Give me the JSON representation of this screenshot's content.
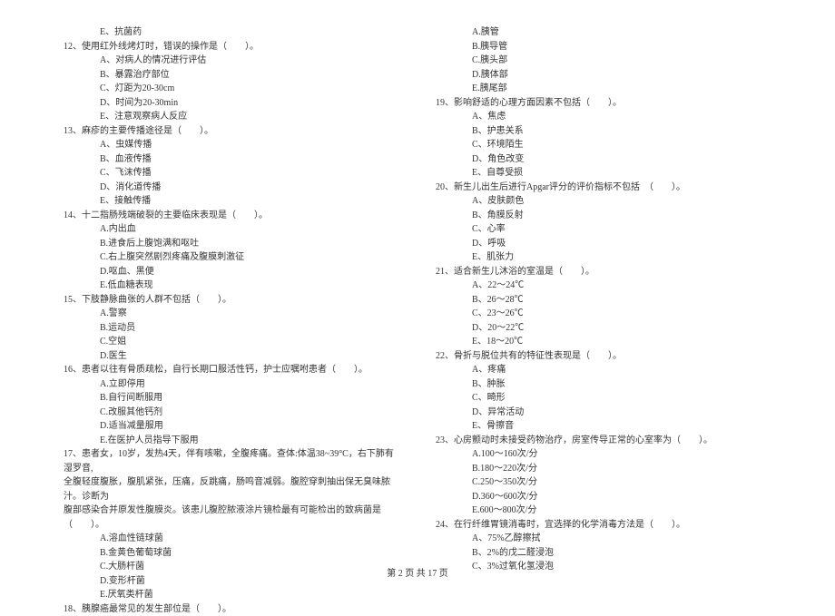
{
  "left": [
    {
      "cls": "opt",
      "t": "E、抗菌药"
    },
    {
      "cls": "q",
      "t": "12、使用红外线烤灯时，错误的操作是（　　）。"
    },
    {
      "cls": "opt",
      "t": "A、对病人的情况进行评估"
    },
    {
      "cls": "opt",
      "t": "B、暴露治疗部位"
    },
    {
      "cls": "opt",
      "t": "C、灯距为20-30cm"
    },
    {
      "cls": "opt",
      "t": "D、时间为20-30min"
    },
    {
      "cls": "opt",
      "t": "E、注意观察病人反应"
    },
    {
      "cls": "q",
      "t": "13、麻疹的主要传播途径是（　　）。"
    },
    {
      "cls": "opt",
      "t": "A、虫媒传播"
    },
    {
      "cls": "opt",
      "t": "B、血液传播"
    },
    {
      "cls": "opt",
      "t": "C、飞沫传播"
    },
    {
      "cls": "opt",
      "t": "D、消化道传播"
    },
    {
      "cls": "opt",
      "t": "E、接触传播"
    },
    {
      "cls": "q",
      "t": "14、十二指肠残端破裂的主要临床表现是（　　）。"
    },
    {
      "cls": "opt",
      "t": "A.内出血"
    },
    {
      "cls": "opt",
      "t": "B.进食后上腹饱满和呕吐"
    },
    {
      "cls": "opt",
      "t": "C.右上腹突然剧烈疼痛及腹膜刺激征"
    },
    {
      "cls": "opt",
      "t": "D.呕血、黑便"
    },
    {
      "cls": "opt",
      "t": "E.低血糖表现"
    },
    {
      "cls": "q",
      "t": "15、下肢静脉曲张的人群不包括（　　）。"
    },
    {
      "cls": "opt",
      "t": "A.警察"
    },
    {
      "cls": "opt",
      "t": "B.运动员"
    },
    {
      "cls": "opt",
      "t": "C.空姐"
    },
    {
      "cls": "opt",
      "t": "D.医生"
    },
    {
      "cls": "q",
      "t": "16、患者以往有骨质疏松，自行长期口服活性钙，护士应嘱咐患者（　　）。"
    },
    {
      "cls": "opt",
      "t": "A.立即停用"
    },
    {
      "cls": "opt",
      "t": "B.自行间断服用"
    },
    {
      "cls": "opt",
      "t": "C.改服其他钙剂"
    },
    {
      "cls": "opt",
      "t": "D.适当减量服用"
    },
    {
      "cls": "opt",
      "t": "E.在医护人员指导下服用"
    },
    {
      "cls": "q",
      "t": "17、患者女，10岁，发热4天，伴有咳嗽，全腹疼痛。查体:体温38~39°C，右下肺有湿罗音,"
    },
    {
      "cls": "q",
      "t": "全腹轻度腹胀，腹肌紧张，压痛，反跳痛，肠鸣音减弱。腹腔穿刺抽出保无臭味脓汁。诊断为"
    },
    {
      "cls": "q",
      "t": "腹部感染合并原发性腹膜炎。该患儿腹腔脓液涂片镜检最有可能检出的致病菌是（　　）。"
    },
    {
      "cls": "opt",
      "t": "A.溶血性链球菌"
    },
    {
      "cls": "opt",
      "t": "B.金黄色葡萄球菌"
    },
    {
      "cls": "opt",
      "t": "C.大肠杆菌"
    },
    {
      "cls": "opt",
      "t": "D.变形杆菌"
    },
    {
      "cls": "opt",
      "t": "E.厌氧类杆菌"
    },
    {
      "cls": "q",
      "t": "18、胰腺癌最常见的发生部位是（　　）。"
    }
  ],
  "right": [
    {
      "cls": "opt",
      "t": "A.胰管"
    },
    {
      "cls": "opt",
      "t": "B.胰导管"
    },
    {
      "cls": "opt",
      "t": "C.胰头部"
    },
    {
      "cls": "opt",
      "t": "D.胰体部"
    },
    {
      "cls": "opt",
      "t": "E.胰尾部"
    },
    {
      "cls": "q",
      "t": "19、影响舒适的心理方面因素不包括（　　）。"
    },
    {
      "cls": "opt",
      "t": "A、焦虑"
    },
    {
      "cls": "opt",
      "t": "B、护患关系"
    },
    {
      "cls": "opt",
      "t": "C、环境陌生"
    },
    {
      "cls": "opt",
      "t": "D、角色改变"
    },
    {
      "cls": "opt",
      "t": "E、自尊受损"
    },
    {
      "cls": "q",
      "t": "20、新生儿出生后进行Apgar评分的评价指标不包括　（　　）。"
    },
    {
      "cls": "opt",
      "t": "A、皮肤颜色"
    },
    {
      "cls": "opt",
      "t": "B、角膜反射"
    },
    {
      "cls": "opt",
      "t": "C、心率"
    },
    {
      "cls": "opt",
      "t": "D、呼吸"
    },
    {
      "cls": "opt",
      "t": "E、肌张力"
    },
    {
      "cls": "q",
      "t": "21、适合新生儿沐浴的室温是（　　）。"
    },
    {
      "cls": "opt",
      "t": "A、22～24℃"
    },
    {
      "cls": "opt",
      "t": "B、26～28℃"
    },
    {
      "cls": "opt",
      "t": "C、23～26℃"
    },
    {
      "cls": "opt",
      "t": "D、20～22℃"
    },
    {
      "cls": "opt",
      "t": "E、18～20℃"
    },
    {
      "cls": "q",
      "t": "22、骨折与脱位共有的特征性表现是（　　）。"
    },
    {
      "cls": "opt",
      "t": "A、疼痛"
    },
    {
      "cls": "opt",
      "t": "B、肿胀"
    },
    {
      "cls": "opt",
      "t": "C、畸形"
    },
    {
      "cls": "opt",
      "t": "D、异常活动"
    },
    {
      "cls": "opt",
      "t": "E、骨擦音"
    },
    {
      "cls": "q",
      "t": "23、心房颤动时未接受药物治疗，房室传导正常的心室率为（　　）。"
    },
    {
      "cls": "opt",
      "t": "A.100～160次/分"
    },
    {
      "cls": "opt",
      "t": "B.180～220次/分"
    },
    {
      "cls": "opt",
      "t": "C.250～350次/分"
    },
    {
      "cls": "opt",
      "t": "D.360～600次/分"
    },
    {
      "cls": "opt",
      "t": "E.600～800次/分"
    },
    {
      "cls": "q",
      "t": "24、在行纤维胃镜消毒时，宜选择的化学消毒方法是（　　）。"
    },
    {
      "cls": "opt",
      "t": "A、75%乙醇擦拭"
    },
    {
      "cls": "opt",
      "t": "B、2%的戊二醛浸泡"
    },
    {
      "cls": "opt",
      "t": "C、3%过氧化氢浸泡"
    }
  ],
  "footer": "第 2 页 共 17 页"
}
